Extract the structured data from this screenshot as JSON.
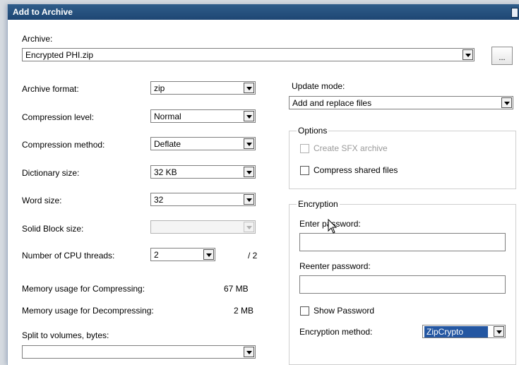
{
  "window": {
    "title": "Add to Archive"
  },
  "archive": {
    "label": "Archive:",
    "value": "Encrypted PHI.zip",
    "browse_label": "..."
  },
  "left": {
    "archive_format": {
      "label": "Archive format:",
      "value": "zip"
    },
    "compression_level": {
      "label": "Compression level:",
      "value": "Normal"
    },
    "compression_method": {
      "label": "Compression method:",
      "value": "Deflate"
    },
    "dictionary_size": {
      "label": "Dictionary size:",
      "value": "32 KB"
    },
    "word_size": {
      "label": "Word size:",
      "value": "32"
    },
    "solid_block_size": {
      "label": "Solid Block size:",
      "value": ""
    },
    "cpu_threads": {
      "label": "Number of CPU threads:",
      "value": "2",
      "max": "/ 2"
    },
    "memory_compress": {
      "label": "Memory usage for Compressing:",
      "value": "67 MB"
    },
    "memory_decompress": {
      "label": "Memory usage for Decompressing:",
      "value": "2 MB"
    },
    "split_volumes": {
      "label": "Split to volumes, bytes:",
      "value": ""
    }
  },
  "right": {
    "update_mode": {
      "label": "Update mode:",
      "value": "Add and replace files"
    },
    "options": {
      "title": "Options",
      "create_sfx": {
        "label": "Create SFX archive",
        "checked": false,
        "enabled": false
      },
      "compress_shared": {
        "label": "Compress shared files",
        "checked": false,
        "enabled": true
      }
    },
    "encryption": {
      "title": "Encryption",
      "enter_password_label": "Enter password:",
      "enter_password_value": "",
      "reenter_password_label": "Reenter password:",
      "reenter_password_value": "",
      "show_password": {
        "label": "Show Password",
        "checked": false
      },
      "method": {
        "label": "Encryption method:",
        "value": "ZipCrypto"
      }
    }
  }
}
